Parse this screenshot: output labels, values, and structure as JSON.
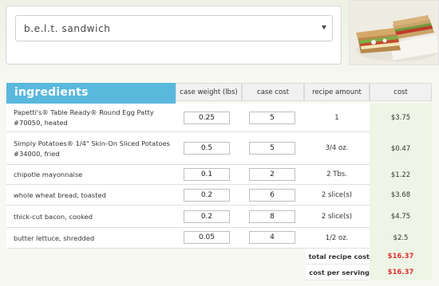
{
  "recipe_select": {
    "selected": "b.e.l.t. sandwich"
  },
  "photo": {
    "icon": "sandwich-photo"
  },
  "table": {
    "title": "ingredients",
    "headers": [
      "case weight (lbs)",
      "case cost",
      "recipe amount",
      "cost"
    ],
    "rows": [
      {
        "name": "Papetti's® Table Ready® Round Egg Patty #70050, heated",
        "case_weight": "0.25",
        "case_cost": "5",
        "recipe_amount": "1",
        "cost": "$3.75"
      },
      {
        "name": "Simply Potatoes® 1/4\" Skin-On Sliced Potatoes #34000, fried",
        "case_weight": "0.5",
        "case_cost": "5",
        "recipe_amount": "3/4 oz.",
        "cost": "$0.47"
      },
      {
        "name": "chipotle mayonnaise",
        "case_weight": "0.1",
        "case_cost": "2",
        "recipe_amount": "2 Tbs.",
        "cost": "$1.22"
      },
      {
        "name": "whole wheat bread, toasted",
        "case_weight": "0.2",
        "case_cost": "6",
        "recipe_amount": "2 slice(s)",
        "cost": "$3.68"
      },
      {
        "name": "thick-cut bacon, cooked",
        "case_weight": "0.2",
        "case_cost": "8",
        "recipe_amount": "2 slice(s)",
        "cost": "$4.75"
      },
      {
        "name": "butter lettuce, shredded",
        "case_weight": "0.05",
        "case_cost": "4",
        "recipe_amount": "1/2 oz.",
        "cost": "$2.5"
      }
    ],
    "totals": {
      "total_label": "total recipe cost",
      "total_value": "$16.37",
      "serving_label": "cost per serving",
      "serving_value": "$16.37"
    }
  }
}
